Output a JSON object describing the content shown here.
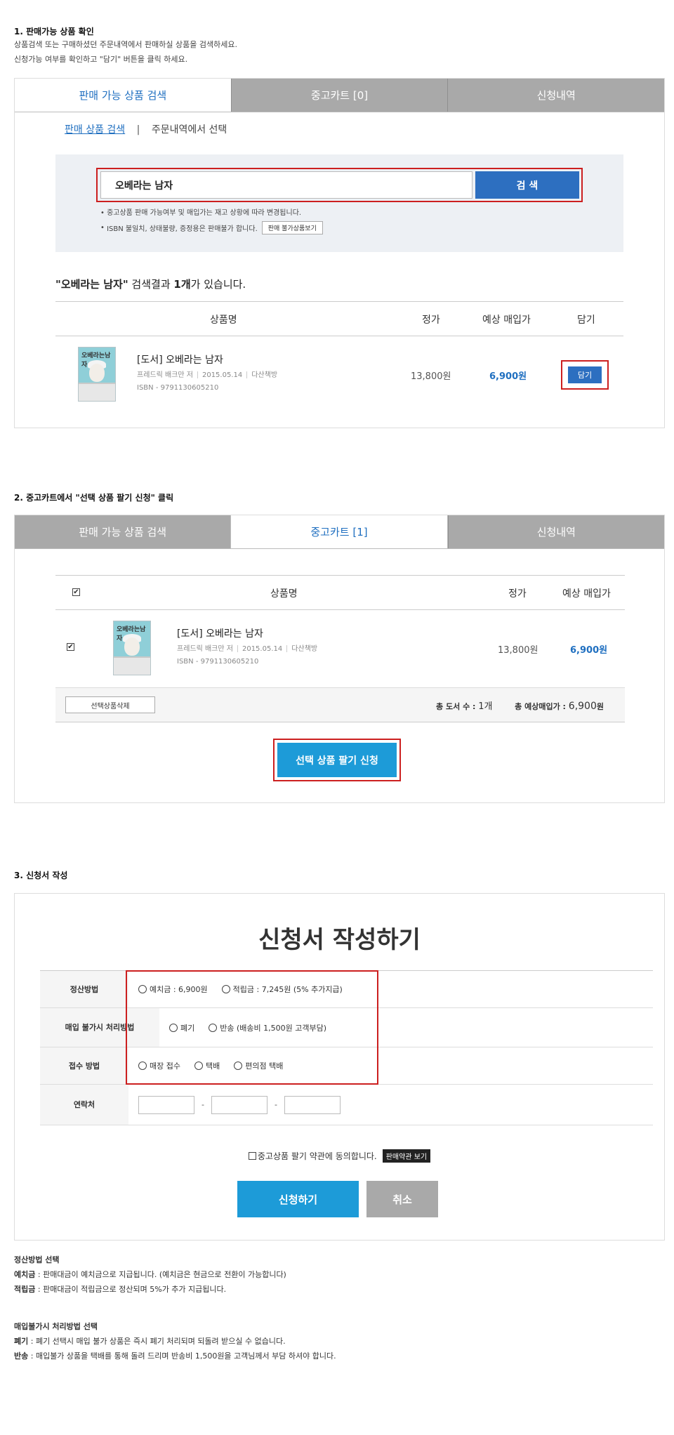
{
  "section1": {
    "title": "1. 판매가능 상품 확인",
    "desc1": "상품검색 또는 구매하셨던 주문내역에서 판매하실 상품을 검색하세요.",
    "desc2": "신청가능 여부를 확인하고 \"담기\" 버튼을 클릭 하세요.",
    "tabs": [
      "판매 가능 상품 검색",
      "중고카트 [0]",
      "신청내역"
    ],
    "subtab_search": "판매 상품 검색",
    "subtab_divider": "|",
    "subtab_order": "주문내역에서 선택",
    "search_value": "오베라는 남자",
    "search_button": "검 색",
    "note1": "중고상품 판매 가능여부 및 매입가는 재고 상황에 따라 변경됩니다.",
    "note2": "ISBN 불일치, 상태불량, 증정용은 판매불가 합니다.",
    "note2_button": "판매 불가상품보기",
    "result_q1": "\"오베라는 남자\"",
    "result_mid": " 검색결과 ",
    "result_count": "1개",
    "result_end": "가 있습니다.",
    "headers": [
      "상품명",
      "정가",
      "예상 매입가",
      "담기"
    ],
    "item": {
      "title": "[도서] 오베라는 남자",
      "author": "프레드릭 배크만 저",
      "date": "2015.05.14",
      "publisher": "다산책방",
      "isbn": "ISBN - 9791130605210",
      "price": "13,800원",
      "buy_price": "6,900원",
      "add_button": "담기",
      "cover_title": "오베라는남자"
    }
  },
  "section2": {
    "title": "2. 중고카트에서 \"선택 상품 팔기 신청\" 클릭",
    "tabs": [
      "판매 가능 상품 검색",
      "중고카트 [1]",
      "신청내역"
    ],
    "headers": [
      "상품명",
      "정가",
      "예상 매입가"
    ],
    "item": {
      "title": "[도서] 오베라는 남자",
      "author": "프레드릭 배크만 저",
      "date": "2015.05.14",
      "publisher": "다산책방",
      "isbn": "ISBN - 9791130605210",
      "price": "13,800원",
      "buy_price": "6,900원",
      "cover_title": "오베라는남자"
    },
    "delete_button": "선택상품삭제",
    "total_count_label": "총 도서 수 : ",
    "total_count": "1개",
    "total_price_label": "총 예상매입가 : ",
    "total_price": "6,900",
    "total_price_unit": "원",
    "apply_button": "선택 상품 팔기 신청"
  },
  "section3": {
    "title": "3. 신청서 작성",
    "form_title": "신청서 작성하기",
    "rows": [
      {
        "label": "정산방법",
        "options": [
          "예치금 : 6,900원",
          "적립금 : 7,245원 (5% 추가지급)"
        ]
      },
      {
        "label": "매입 불가시 처리방법",
        "options": [
          "폐기",
          "반송 (배송비 1,500원 고객부담)"
        ]
      },
      {
        "label": "접수 방법",
        "options": [
          "매장 접수",
          "택배",
          "편의점 택배"
        ]
      },
      {
        "label": "연락처"
      }
    ],
    "phone_sep": "-",
    "agree_text": "중고상품 팔기 약관에 동의합니다.",
    "terms_button": "판매약관 보기",
    "submit_button": "신청하기",
    "cancel_button": "취소"
  },
  "footnotes": {
    "settle_title": "정산방법 선택",
    "settle_1_label": "예치금",
    "settle_1_text": " : 판매대금이 예치금으로 지급됩니다. (예치금은 현금으로 전환이 가능합니다)",
    "settle_2_label": "적립금",
    "settle_2_text": " : 판매대금이 적립금으로 정산되며 5%가 추가 지급됩니다.",
    "fail_title": "매입불가시 처리방법 선택",
    "fail_1_label": "폐기",
    "fail_1_text": " : 폐기 선택시 매입 불가 상품은 즉시 폐기 처리되며 되돌려 받으실 수 없습니다.",
    "fail_2_label": "반송",
    "fail_2_text": " : 매입불가 상품을 택배를 통해 돌려 드리며 반송비 1,500원을 고객님께서 부담 하셔야 합니다."
  }
}
